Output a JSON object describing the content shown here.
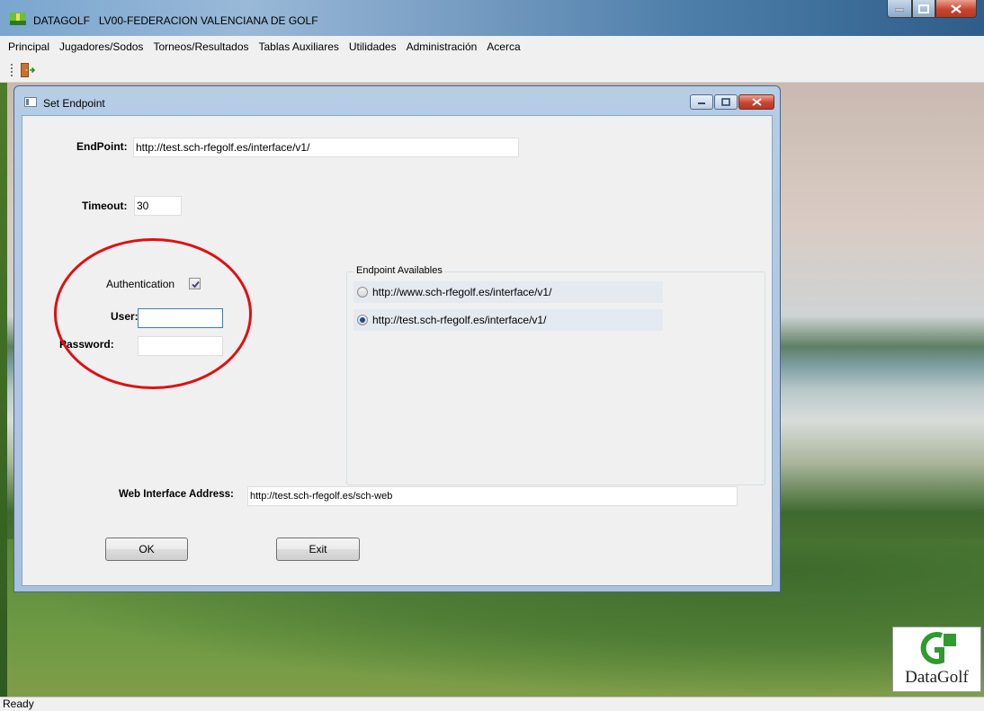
{
  "app": {
    "title": "DATAGOLF   LV00-FEDERACION VALENCIANA DE GOLF",
    "menu": [
      "Principal",
      "Jugadores/Sodos",
      "Torneos/Resultados",
      "Tablas Auxiliares",
      "Utilidades",
      "Administración",
      "Acerca"
    ],
    "status": "Ready",
    "logo_text": "DataGolf"
  },
  "dialog": {
    "title": "Set Endpoint",
    "endpoint_label": "EndPoint:",
    "endpoint_value": "http://test.sch-rfegolf.es/interface/v1/",
    "timeout_label": "Timeout:",
    "timeout_value": "30",
    "authentication_label": "Authentication",
    "authentication_checked": true,
    "user_label": "User:",
    "user_value": "",
    "password_label": "Password:",
    "password_value": "",
    "group_title": "Endpoint Availables",
    "endpoints": [
      {
        "label": "http://www.sch-rfegolf.es/interface/v1/",
        "selected": false
      },
      {
        "label": "http://test.sch-rfegolf.es/interface/v1/",
        "selected": true
      }
    ],
    "web_label": "Web Interface Address:",
    "web_value": "http://test.sch-rfegolf.es/sch-web",
    "ok_label": "OK",
    "exit_label": "Exit"
  },
  "colors": {
    "annotation": "#e01010",
    "radio_dot": "#1e4f8a",
    "close_button": "#c9452e"
  },
  "icons": {
    "app": "datagolf-app-icon",
    "toolbar_exit": "exit-door-icon",
    "dialog": "window-icon"
  }
}
